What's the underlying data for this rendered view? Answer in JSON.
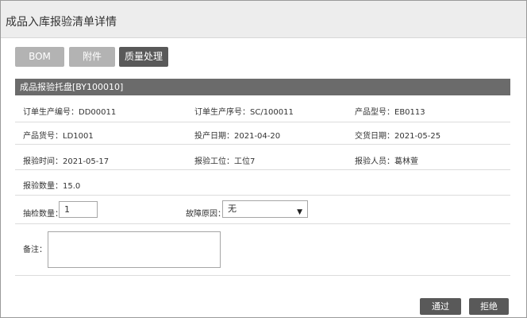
{
  "title": "成品入库报验清单详情",
  "tabs": [
    {
      "label": "BOM",
      "active": false
    },
    {
      "label": "附件",
      "active": false
    },
    {
      "label": "质量处理",
      "active": true
    }
  ],
  "section_title": "成品报验托盘[BY100010]",
  "fields": {
    "order_no": "订单生产编号：DD00011",
    "order_seq": "订单生产序号：SC/100011",
    "product_model": "产品型号：EB0113",
    "product_code": "产品货号：LD1001",
    "production_date": "投产日期：2021-04-20",
    "delivery_date": "交货日期：2021-05-25",
    "inspect_time": "报验时间：2021-05-17",
    "inspect_station": "报验工位：工位7",
    "inspector": "报验人员：葛林萱",
    "inspect_qty": "报验数量：15.0"
  },
  "form": {
    "sample_qty_label": "抽检数量：",
    "sample_qty_value": "1",
    "fault_reason_label": "故障原因：",
    "fault_reason_value": "无",
    "remark_label": "备注："
  },
  "buttons": {
    "pass": "通过",
    "reject": "拒绝"
  },
  "colors": {
    "tab_active": "#595959",
    "tab_inactive": "#b3b3b3",
    "section_bar": "#6b6b6b",
    "title_bar": "#ededed"
  }
}
